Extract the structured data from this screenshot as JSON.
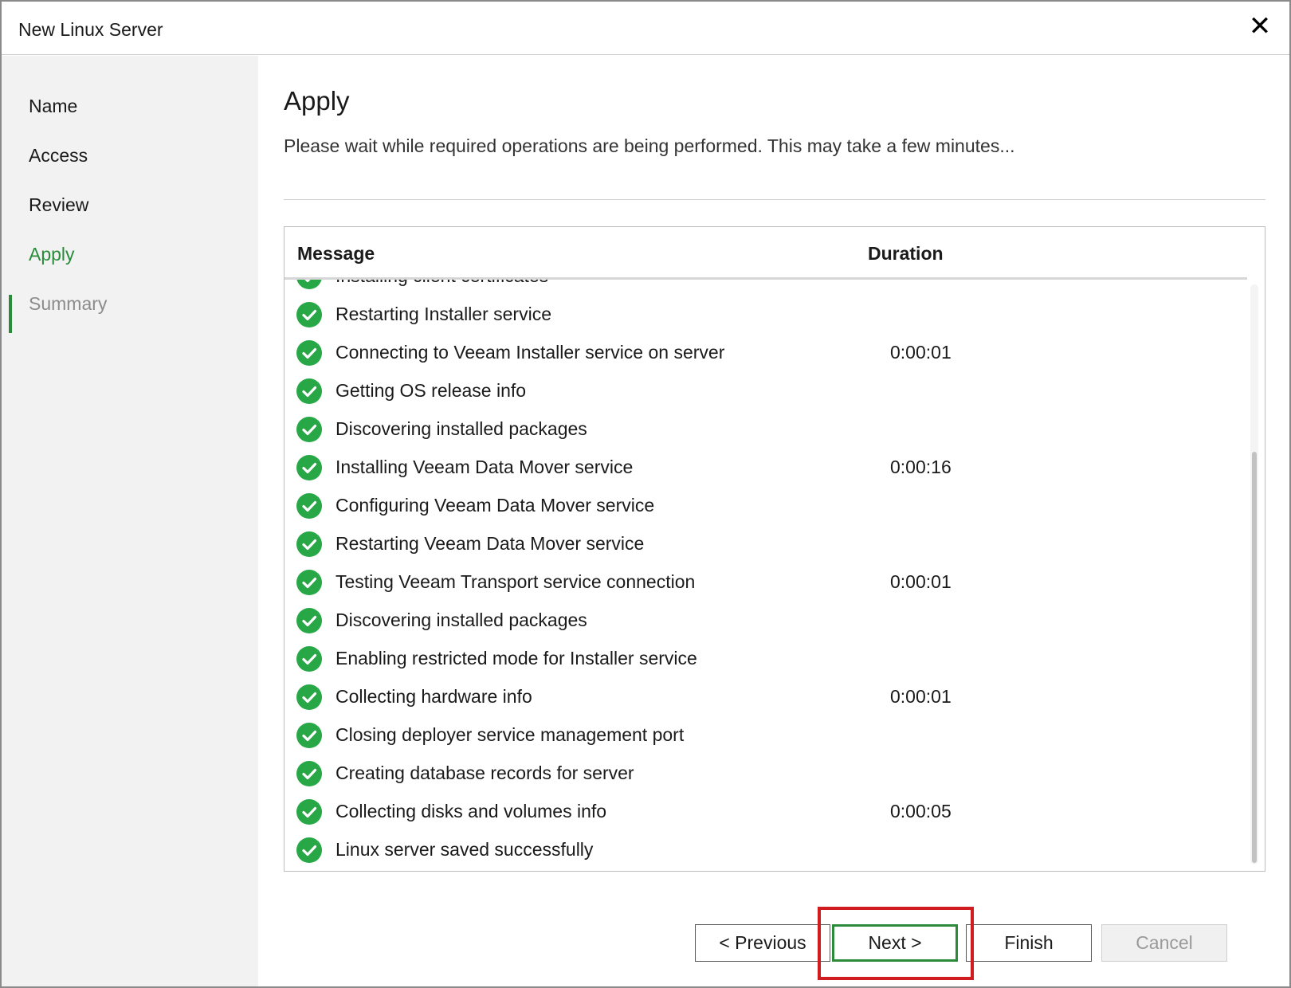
{
  "window": {
    "title": "New Linux Server",
    "close_icon": "close-icon"
  },
  "sidebar": {
    "steps": [
      {
        "label": "Name",
        "state": "done"
      },
      {
        "label": "Access",
        "state": "done"
      },
      {
        "label": "Review",
        "state": "done"
      },
      {
        "label": "Apply",
        "state": "active"
      },
      {
        "label": "Summary",
        "state": "disabled"
      }
    ]
  },
  "page": {
    "title": "Apply",
    "description": "Please wait while required operations are being performed. This may take a few minutes..."
  },
  "log": {
    "columns": {
      "message": "Message",
      "duration": "Duration"
    },
    "rows": [
      {
        "message": "Installing client certificates",
        "duration": ""
      },
      {
        "message": "Restarting Installer service",
        "duration": ""
      },
      {
        "message": "Connecting to Veeam Installer service on server",
        "duration": "0:00:01"
      },
      {
        "message": "Getting OS release info",
        "duration": ""
      },
      {
        "message": "Discovering installed packages",
        "duration": ""
      },
      {
        "message": "Installing Veeam Data Mover service",
        "duration": "0:00:16"
      },
      {
        "message": "Configuring Veeam Data Mover service",
        "duration": ""
      },
      {
        "message": "Restarting Veeam Data Mover service",
        "duration": ""
      },
      {
        "message": "Testing Veeam Transport service connection",
        "duration": "0:00:01"
      },
      {
        "message": "Discovering installed packages",
        "duration": ""
      },
      {
        "message": "Enabling restricted mode for Installer service",
        "duration": ""
      },
      {
        "message": "Collecting hardware info",
        "duration": "0:00:01"
      },
      {
        "message": "Closing deployer service management port",
        "duration": ""
      },
      {
        "message": "Creating database records for server",
        "duration": ""
      },
      {
        "message": "Collecting disks and volumes info",
        "duration": "0:00:05"
      },
      {
        "message": "Linux server saved successfully",
        "duration": ""
      }
    ],
    "status_icon": "check-circle-icon",
    "status_color": "#27a745"
  },
  "buttons": {
    "previous": "< Previous",
    "next": "Next >",
    "finish": "Finish",
    "cancel": "Cancel"
  },
  "colors": {
    "accent": "#2a8c3a",
    "highlight": "#d01c1f"
  }
}
